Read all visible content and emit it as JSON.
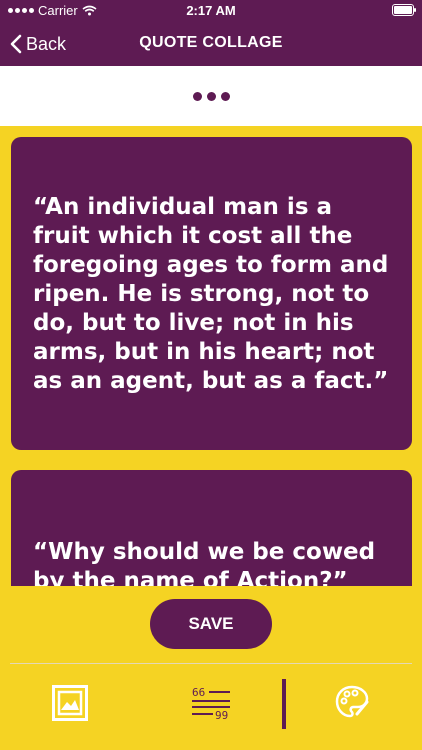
{
  "status_bar": {
    "carrier": "Carrier",
    "time": "2:17 AM"
  },
  "nav": {
    "back_label": "Back",
    "title": "QUOTE COLLAGE"
  },
  "quotes": [
    {
      "text": "“An individual man is a fruit which it cost all the foregoing ages to form and ripen. He is strong, not to do, but to live; not in his arms, but in his heart; not as an agent, but as a fact.”"
    },
    {
      "text": "“Why should we be cowed by the name of Action?”"
    }
  ],
  "actions": {
    "save_label": "SAVE"
  },
  "toolbar": {
    "icons": [
      "image-icon",
      "quote-style-icon",
      "palette-icon"
    ]
  },
  "colors": {
    "primary": "#5E1B53",
    "background": "#F5D323",
    "surface": "#FFFFFF"
  }
}
